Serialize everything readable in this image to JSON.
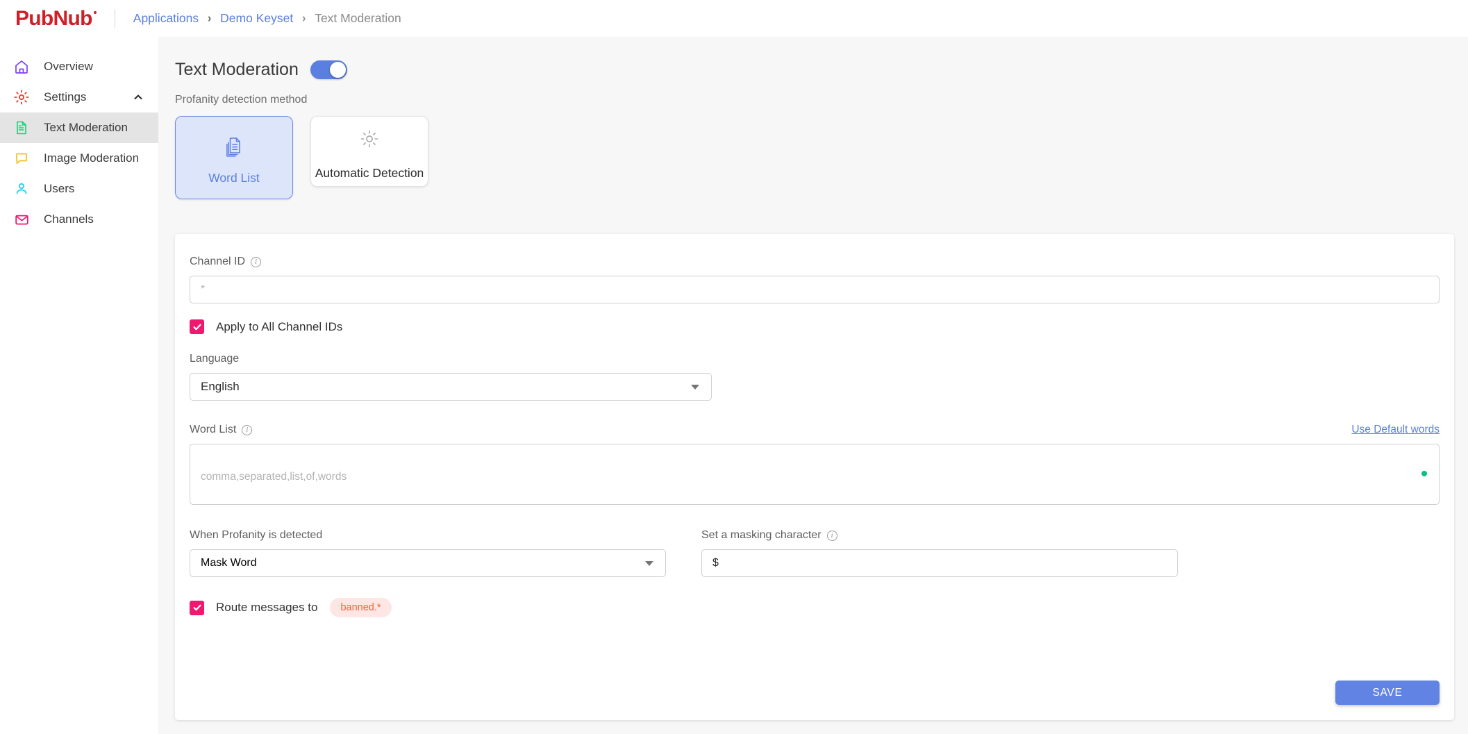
{
  "brand": {
    "name": "PubNub"
  },
  "breadcrumb": {
    "applications": "Applications",
    "keyset": "Demo Keyset",
    "current": "Text Moderation",
    "separator": "›"
  },
  "sidebar": {
    "items": [
      {
        "label": "Overview",
        "icon": "home-icon",
        "color": "#7b3ff2"
      },
      {
        "label": "Settings",
        "icon": "gear-icon",
        "color": "#f03a2e"
      },
      {
        "label": "Text Moderation",
        "icon": "document-icon",
        "color": "#12d47a"
      },
      {
        "label": "Image Moderation",
        "icon": "chat-icon",
        "color": "#f5c020"
      },
      {
        "label": "Users",
        "icon": "user-icon",
        "color": "#22cdf0"
      },
      {
        "label": "Channels",
        "icon": "envelope-icon",
        "color": "#f0186f"
      }
    ]
  },
  "page": {
    "title": "Text Moderation",
    "toggle_on": true,
    "method_label": "Profanity detection method",
    "methods": [
      {
        "label": "Word List",
        "icon": "documents-icon",
        "selected": true
      },
      {
        "label": "Automatic Detection",
        "icon": "gear-outline-icon",
        "selected": false
      }
    ]
  },
  "form": {
    "channel_id": {
      "label": "Channel ID",
      "value": "*",
      "placeholder": "*"
    },
    "apply_all": {
      "label": "Apply to All Channel IDs",
      "checked": true
    },
    "language": {
      "label": "Language",
      "value": "English"
    },
    "word_list": {
      "label": "Word List",
      "link": "Use Default words",
      "placeholder": "comma,separated,list,of,words",
      "value": ""
    },
    "profanity_action": {
      "label": "When Profanity is detected",
      "value": "Mask Word"
    },
    "masking_character": {
      "label": "Set a masking character",
      "value": "$"
    },
    "route": {
      "label": "Route messages to",
      "badge": "banned.*",
      "checked": true
    },
    "save_label": "SAVE"
  },
  "colors": {
    "brand_red": "#cf2028",
    "accent_blue": "#5b7fe0",
    "checkbox_pink": "#f0186f",
    "badge_bg": "#fde6e3",
    "badge_text": "#f0643c",
    "green_dot": "#0fbf7e"
  }
}
